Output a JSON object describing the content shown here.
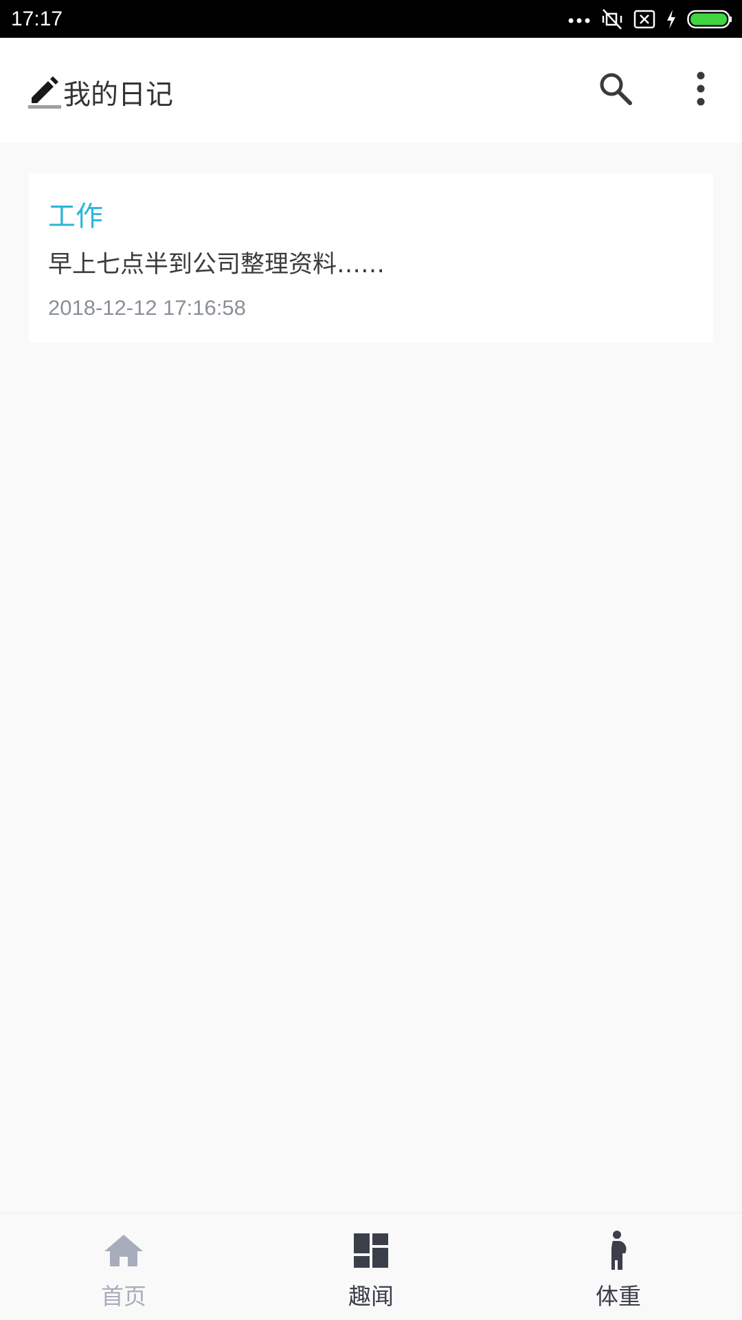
{
  "status_bar": {
    "time": "17:17",
    "icons": [
      "more-dots-icon",
      "vibrate-mute-icon",
      "sim-x-icon",
      "charging-icon",
      "battery-icon"
    ],
    "battery_color": "#3fd63f"
  },
  "app_bar": {
    "title": "我的日记",
    "title_icon": "pencil-icon",
    "actions": [
      "search-icon",
      "overflow-menu-icon"
    ]
  },
  "entries": [
    {
      "category": "工作",
      "text": "早上七点半到公司整理资料……",
      "date": "2018-12-12 17:16:58"
    }
  ],
  "bottom_nav": {
    "items": [
      {
        "label": "首页",
        "icon": "home-icon",
        "active": true
      },
      {
        "label": "趣闻",
        "icon": "dashboard-icon",
        "active": false
      },
      {
        "label": "体重",
        "icon": "pregnant-person-icon",
        "active": false
      }
    ]
  },
  "colors": {
    "accent": "#29b6d8",
    "nav_active": "#a7adba",
    "nav_inactive": "#3a3f4a"
  }
}
